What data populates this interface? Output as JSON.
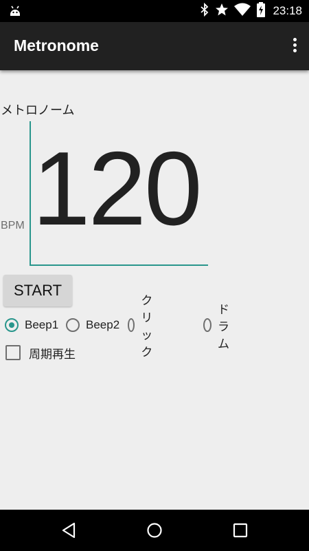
{
  "status_bar": {
    "time": "23:18",
    "icons": [
      "android-debug-icon",
      "bluetooth-icon",
      "star-icon",
      "wifi-icon",
      "battery-charging-icon"
    ]
  },
  "app_bar": {
    "title": "Metronome",
    "menu_icon": "overflow-menu-icon"
  },
  "main": {
    "section_label": "メトロノーム",
    "bpm_unit": "BPM",
    "bpm_value": "120",
    "start_label": "START",
    "sounds": [
      {
        "label": "Beep1",
        "selected": true
      },
      {
        "label": "Beep2",
        "selected": false
      },
      {
        "label": "クリック",
        "selected": false
      },
      {
        "label": "ドラム",
        "selected": false
      }
    ],
    "periodic_label": "周期再生",
    "periodic_checked": false
  },
  "nav_bar": {
    "buttons": [
      "back-icon",
      "home-icon",
      "recents-icon"
    ]
  },
  "colors": {
    "accent": "#29968c",
    "app_bar": "#212121",
    "background": "#eeeeee"
  }
}
